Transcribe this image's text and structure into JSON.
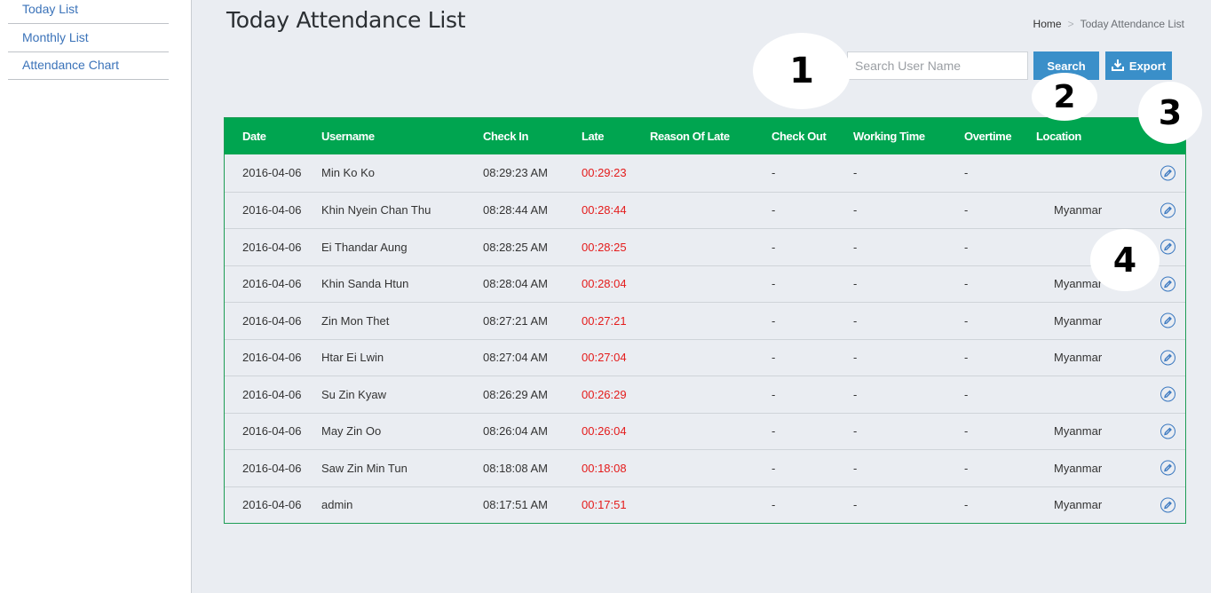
{
  "sidebar": {
    "items": [
      {
        "label": "Today List"
      },
      {
        "label": "Monthly List"
      },
      {
        "label": "Attendance Chart"
      }
    ]
  },
  "header": {
    "title": "Today Attendance List",
    "breadcrumb": {
      "home": "Home",
      "separator": ">",
      "current": "Today Attendance List"
    }
  },
  "toolbar": {
    "search_placeholder": "Search User Name",
    "search_value": "",
    "search_label": "Search",
    "export_label": "Export"
  },
  "callouts": [
    "1",
    "2",
    "3",
    "4"
  ],
  "table": {
    "columns": [
      "Date",
      "Username",
      "Check In",
      "Late",
      "Reason Of Late",
      "Check Out",
      "Working Time",
      "Overtime",
      "Location"
    ],
    "rows": [
      {
        "date": "2016-04-06",
        "user": "Min Ko Ko",
        "check_in": "08:29:23 AM",
        "late": "00:29:23",
        "reason": "",
        "check_out": "-",
        "working": "-",
        "overtime": "-",
        "location": ""
      },
      {
        "date": "2016-04-06",
        "user": "Khin Nyein Chan Thu",
        "check_in": "08:28:44 AM",
        "late": "00:28:44",
        "reason": "",
        "check_out": "-",
        "working": "-",
        "overtime": "-",
        "location": "Myanmar"
      },
      {
        "date": "2016-04-06",
        "user": "Ei Thandar Aung",
        "check_in": "08:28:25 AM",
        "late": "00:28:25",
        "reason": "",
        "check_out": "-",
        "working": "-",
        "overtime": "-",
        "location": ""
      },
      {
        "date": "2016-04-06",
        "user": "Khin Sanda Htun",
        "check_in": "08:28:04 AM",
        "late": "00:28:04",
        "reason": "",
        "check_out": "-",
        "working": "-",
        "overtime": "-",
        "location": "Myanmar"
      },
      {
        "date": "2016-04-06",
        "user": "Zin Mon Thet",
        "check_in": "08:27:21 AM",
        "late": "00:27:21",
        "reason": "",
        "check_out": "-",
        "working": "-",
        "overtime": "-",
        "location": "Myanmar"
      },
      {
        "date": "2016-04-06",
        "user": "Htar Ei Lwin",
        "check_in": "08:27:04 AM",
        "late": "00:27:04",
        "reason": "",
        "check_out": "-",
        "working": "-",
        "overtime": "-",
        "location": "Myanmar"
      },
      {
        "date": "2016-04-06",
        "user": "Su Zin Kyaw",
        "check_in": "08:26:29 AM",
        "late": "00:26:29",
        "reason": "",
        "check_out": "-",
        "working": "-",
        "overtime": "-",
        "location": ""
      },
      {
        "date": "2016-04-06",
        "user": "May Zin Oo",
        "check_in": "08:26:04 AM",
        "late": "00:26:04",
        "reason": "",
        "check_out": "-",
        "working": "-",
        "overtime": "-",
        "location": "Myanmar"
      },
      {
        "date": "2016-04-06",
        "user": "Saw Zin Min Tun",
        "check_in": "08:18:08 AM",
        "late": "00:18:08",
        "reason": "",
        "check_out": "-",
        "working": "-",
        "overtime": "-",
        "location": "Myanmar"
      },
      {
        "date": "2016-04-06",
        "user": "admin",
        "check_in": "08:17:51 AM",
        "late": "00:17:51",
        "reason": "",
        "check_out": "-",
        "working": "-",
        "overtime": "-",
        "location": "Myanmar"
      }
    ]
  },
  "colors": {
    "header_green": "#00a550",
    "button_blue": "#3a8fc9",
    "late_red": "#e41b1b",
    "link_blue": "#3b73b9"
  },
  "icons": {
    "export": "download-icon",
    "edit": "edit-pencil-icon"
  }
}
